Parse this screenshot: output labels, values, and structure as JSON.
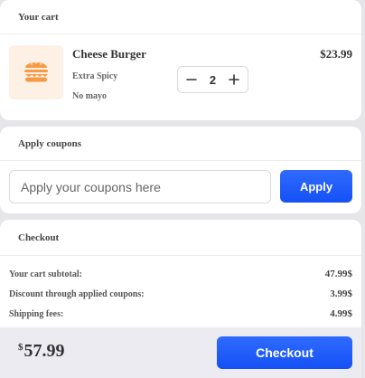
{
  "cart": {
    "title": "Your cart",
    "item": {
      "name": "Cheese Burger",
      "option1": "Extra Spicy",
      "option2": "No mayo",
      "quantity": "2",
      "price": "$23.99",
      "icon": "burger-icon"
    }
  },
  "coupons": {
    "title": "Apply coupons",
    "placeholder": "Apply your coupons here",
    "value": "",
    "apply_label": "Apply"
  },
  "checkout": {
    "title": "Checkout",
    "rows": [
      {
        "label": "Your cart subtotal:",
        "value": "47.99$"
      },
      {
        "label": "Discount through applied coupons:",
        "value": "3.99$"
      },
      {
        "label": "Shipping fees:",
        "value": "4.99$"
      }
    ],
    "currency_symbol": "$",
    "total": "57.99",
    "button_label": "Checkout"
  },
  "colors": {
    "accent": "#1a5bff",
    "thumb_bg": "#fdf1e6",
    "burger": "#f79a45"
  }
}
